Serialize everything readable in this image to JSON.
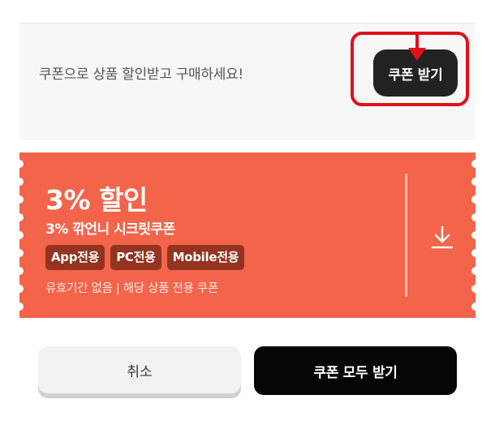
{
  "promo": {
    "text": "쿠폰으로 상품 할인받고 구매하세요!",
    "button_label": "쿠폰 받기"
  },
  "coupon": {
    "discount": "3% 할인",
    "name": "3% 깎언니 시크릿쿠폰",
    "tags": [
      "App전용",
      "PC전용",
      "Mobile전용"
    ],
    "info": "유효기간 없음 | 해당 상품 전용 쿠폰"
  },
  "footer": {
    "cancel_label": "취소",
    "receive_all_label": "쿠폰 모두 받기"
  },
  "icons": {
    "download": "download-icon",
    "pointer_arrow": "arrow-down-icon"
  },
  "colors": {
    "coupon_bg": "#f4644a",
    "tag_bg": "#933320",
    "highlight": "#e0101a",
    "dark_button": "#222222"
  }
}
